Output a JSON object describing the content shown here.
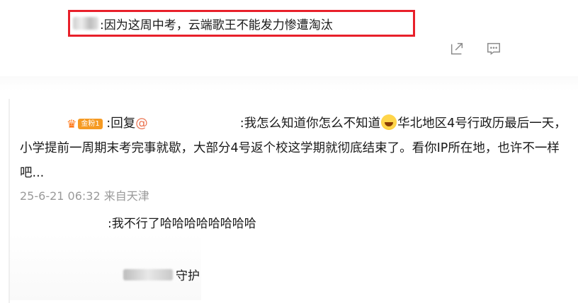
{
  "top_comment": {
    "text": ":因为这周中考，云端歌王不能发力惨遭淘汰"
  },
  "actions": {
    "share_icon": "share-icon",
    "comment_icon": "comment-icon"
  },
  "reply": {
    "badge_label": "金粉1",
    "reply_prefix": ":回复",
    "mention": "@",
    "text_part1": ":我怎么知道你怎么不知道",
    "text_part2": "华北地区4号行政历最后一天，小学提前一周期末考完事就歇，大部分4号返个校这学期就彻底结束了。看你IP所在地，也许不一样吧...",
    "emoji": "laughing-emoji",
    "timestamp": "25-6-21 06:32 来自天津"
  },
  "sub_reply": {
    "text": ":我不行了哈哈哈哈哈哈哈哈"
  },
  "guard": {
    "text": "守护"
  },
  "colors": {
    "highlight_border": "#e8202a",
    "mention": "#eb7350",
    "badge": "#f59a23"
  }
}
